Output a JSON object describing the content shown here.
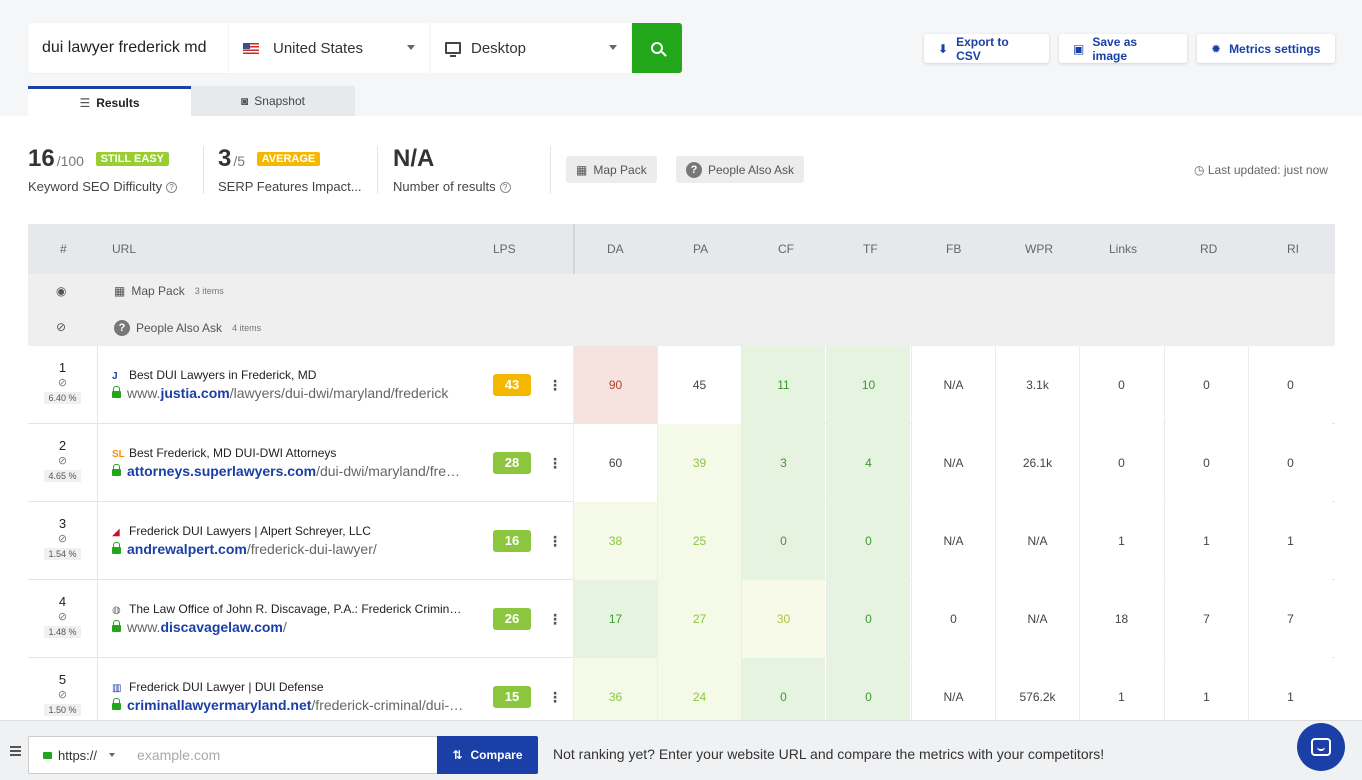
{
  "search": {
    "keyword": "dui lawyer frederick md",
    "country": "United States",
    "device": "Desktop"
  },
  "actions": {
    "export": "Export to CSV",
    "save": "Save as image",
    "metrics": "Metrics settings"
  },
  "tabs": {
    "results": "Results",
    "snapshot": "Snapshot"
  },
  "metrics": {
    "difficulty": {
      "value": "16",
      "of": "/100",
      "badge": "STILL EASY",
      "badge_color": "#9acd32",
      "label": "Keyword SEO Difficulty"
    },
    "serp": {
      "value": "3",
      "of": "/5",
      "badge": "AVERAGE",
      "badge_color": "#f5b800",
      "label": "SERP Features Impact..."
    },
    "results": {
      "value": "N/A",
      "label": "Number of results"
    }
  },
  "chips": {
    "map_pack": "Map Pack",
    "people_also_ask": "People Also Ask"
  },
  "last_updated": "Last updated: just now",
  "table": {
    "headers": {
      "rank": "#",
      "url": "URL",
      "lps": "LPS",
      "da": "DA",
      "pa": "PA",
      "cf": "CF",
      "tf": "TF",
      "fb": "FB",
      "wpr": "WPR",
      "links": "Links",
      "rd": "RD",
      "ri": "RI"
    },
    "special": [
      {
        "name": "Map Pack",
        "count": "3 items"
      },
      {
        "name": "People Also Ask",
        "count": "4 items"
      }
    ],
    "rows": [
      {
        "rank": "1",
        "ctr": "6.40 %",
        "title": "Best DUI Lawyers in Frederick, MD",
        "favicon": "J",
        "prefix": "www.",
        "domain": "justia.com",
        "path": "/lawyers/dui-dwi/maryland/frederick",
        "lps": "43",
        "lps_color": "#f5b800",
        "da": "90",
        "pa": "45",
        "cf": "11",
        "tf": "10",
        "fb": "N/A",
        "wpr": "3.1k",
        "links": "0",
        "rd": "0",
        "ri": "0"
      },
      {
        "rank": "2",
        "ctr": "4.65 %",
        "title": "Best Frederick, MD DUI-DWI Attorneys",
        "favicon": "SL",
        "prefix": "",
        "domain": "attorneys.superlawyers.com",
        "path": "/dui-dwi/maryland/frederick/",
        "lps": "28",
        "lps_color": "#8cc63f",
        "da": "60",
        "pa": "39",
        "cf": "3",
        "tf": "4",
        "fb": "N/A",
        "wpr": "26.1k",
        "links": "0",
        "rd": "0",
        "ri": "0"
      },
      {
        "rank": "3",
        "ctr": "1.54 %",
        "title": "Frederick DUI Lawyers | Alpert Schreyer, LLC",
        "favicon": "◢",
        "prefix": "",
        "domain": "andrewalpert.com",
        "path": "/frederick-dui-lawyer/",
        "lps": "16",
        "lps_color": "#8cc63f",
        "da": "38",
        "pa": "25",
        "cf": "0",
        "tf": "0",
        "fb": "N/A",
        "wpr": "N/A",
        "links": "1",
        "rd": "1",
        "ri": "1"
      },
      {
        "rank": "4",
        "ctr": "1.48 %",
        "title": "The Law Office of John R. Discavage, P.A.: Frederick Criminal Lawyer",
        "favicon": "◍",
        "prefix": "www.",
        "domain": "discavagelaw.com",
        "path": "/",
        "lps": "26",
        "lps_color": "#8cc63f",
        "da": "17",
        "pa": "27",
        "cf": "30",
        "tf": "0",
        "fb": "0",
        "wpr": "N/A",
        "links": "18",
        "rd": "7",
        "ri": "7"
      },
      {
        "rank": "5",
        "ctr": "1.50 %",
        "title": "Frederick DUI Lawyer | DUI Defense",
        "favicon": "▥",
        "prefix": "",
        "domain": "criminallawyermaryland.net",
        "path": "/frederick-criminal/dui-lawyer/",
        "lps": "15",
        "lps_color": "#8cc63f",
        "da": "36",
        "pa": "24",
        "cf": "0",
        "tf": "0",
        "fb": "N/A",
        "wpr": "576.2k",
        "links": "1",
        "rd": "1",
        "ri": "1"
      }
    ]
  },
  "compare": {
    "protocol": "https://",
    "placeholder": "example.com",
    "button": "Compare",
    "message": "Not ranking yet? Enter your website URL and compare the metrics with your competitors!"
  }
}
